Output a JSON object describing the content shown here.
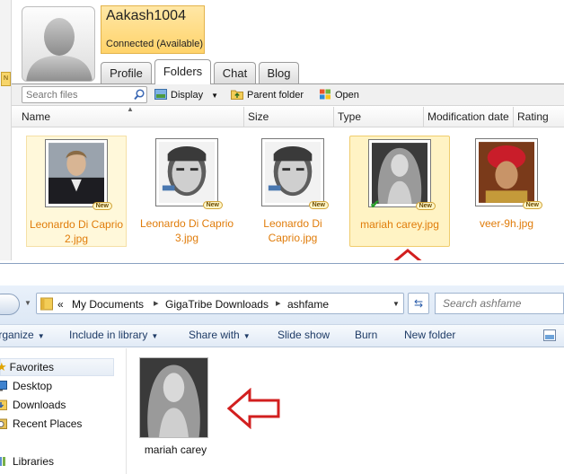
{
  "gigatribe": {
    "username": "Aakash1004",
    "status": "Connected (Available)",
    "tabs": [
      "Profile",
      "Folders",
      "Chat",
      "Blog"
    ],
    "active_tab": "Folders",
    "search_placeholder": "Search files",
    "toolbar": {
      "display": "Display",
      "parent_folder": "Parent folder",
      "open": "Open"
    },
    "columns": [
      "Name",
      "Size",
      "Type",
      "Modification date",
      "Rating"
    ],
    "files": [
      {
        "name": "Leonardo Di Caprio 2.jpg",
        "badge": "New"
      },
      {
        "name": "Leonardo Di Caprio 3.jpg",
        "badge": "New"
      },
      {
        "name": "Leonardo Di Caprio.jpg",
        "badge": "New"
      },
      {
        "name": "mariah carey.jpg",
        "badge": "New"
      },
      {
        "name": "veer-9h.jpg",
        "badge": "New"
      }
    ],
    "left_strip_tag": "N"
  },
  "explorer": {
    "breadcrumb": [
      "My Documents",
      "GigaTribe Downloads",
      "ashfame"
    ],
    "breadcrumb_prefix": "«",
    "search_placeholder": "Search ashfame",
    "commands": [
      "Organize",
      "Include in library",
      "Share with",
      "Slide show",
      "Burn",
      "New folder"
    ],
    "nav": {
      "favorites": "Favorites",
      "items": [
        "Desktop",
        "Downloads",
        "Recent Places"
      ],
      "libraries": "Libraries"
    },
    "file": {
      "name": "mariah carey"
    }
  },
  "colors": {
    "accent_orange": "#e07c0a",
    "arrow_red": "#d21f1f",
    "selection": "#fff3c4",
    "explorer_text": "#1e3b66"
  }
}
